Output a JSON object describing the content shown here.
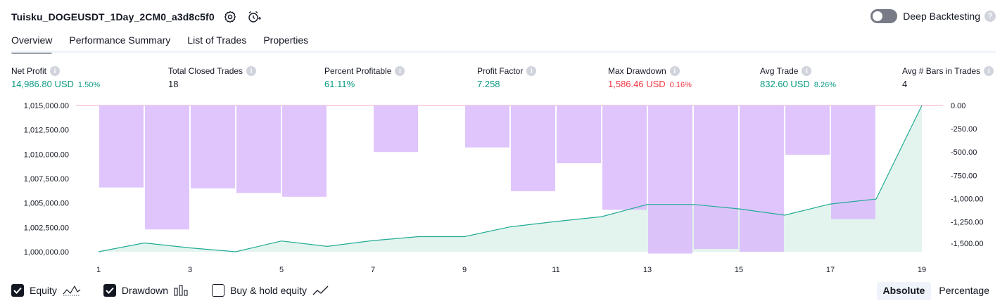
{
  "strategy": {
    "title": "Tuisku_DOGEUSDT_1Day_2CM0_a3d8c5f0",
    "settings_icon": "gear-icon",
    "alert_icon": "alarm-clock-plus-icon"
  },
  "deep_backtesting": {
    "label": "Deep Backtesting",
    "enabled": false,
    "help": "?"
  },
  "tabs": [
    {
      "label": "Overview",
      "active": true
    },
    {
      "label": "Performance Summary",
      "active": false
    },
    {
      "label": "List of Trades",
      "active": false
    },
    {
      "label": "Properties",
      "active": false
    }
  ],
  "metrics": [
    {
      "label": "Net Profit",
      "value": "14,986.80 USD",
      "pct": "1.50%",
      "color": "green"
    },
    {
      "label": "Total Closed Trades",
      "value": "18",
      "pct": "",
      "color": "black"
    },
    {
      "label": "Percent Profitable",
      "value": "61.11%",
      "pct": "",
      "color": "green"
    },
    {
      "label": "Profit Factor",
      "value": "7.258",
      "pct": "",
      "color": "green"
    },
    {
      "label": "Max Drawdown",
      "value": "1,586.46 USD",
      "pct": "0.16%",
      "color": "red"
    },
    {
      "label": "Avg Trade",
      "value": "832.60 USD",
      "pct": "8.26%",
      "color": "green"
    },
    {
      "label": "Avg # Bars in Trades",
      "value": "4",
      "pct": "",
      "color": "black"
    }
  ],
  "chart_data": {
    "type": "line",
    "series": [
      {
        "name": "Equity",
        "axis": "left",
        "chart": "area",
        "x": [
          1,
          2,
          3,
          4,
          5,
          6,
          7,
          8,
          9,
          10,
          11,
          12,
          13,
          14,
          15,
          16,
          17,
          18,
          19
        ],
        "values": [
          1000000,
          1000900,
          1000400,
          1000000,
          1001100,
          1000550,
          1001150,
          1001550,
          1001550,
          1002550,
          1003100,
          1003600,
          1004850,
          1004850,
          1004400,
          1003750,
          1004900,
          1005400,
          1015000
        ]
      },
      {
        "name": "Drawdown",
        "axis": "right",
        "chart": "bar",
        "x": [
          2,
          3,
          4,
          5,
          6,
          7,
          8,
          9,
          10,
          11,
          12,
          13,
          14,
          15,
          16,
          17,
          18,
          19
        ],
        "values": [
          -880,
          -1330,
          -890,
          -940,
          -980,
          0,
          -500,
          0,
          -450,
          -920,
          -620,
          -1120,
          -1590,
          -1540,
          -1570,
          -530,
          -1220,
          0
        ]
      }
    ],
    "left_axis": {
      "ticks": [
        "1,015,000.00",
        "1,012,500.00",
        "1,010,000.00",
        "1,007,500.00",
        "1,005,000.00",
        "1,002,500.00",
        "1,000,000.00"
      ],
      "range": [
        1000000,
        1015000
      ]
    },
    "right_axis": {
      "ticks": [
        "0.00",
        "-250.00",
        "-500.00",
        "-750.00",
        "-1,000.00",
        "-1,250.00",
        "-1,500.00"
      ],
      "range": [
        -1570,
        0
      ]
    },
    "x_ticks": [
      "1",
      "3",
      "5",
      "7",
      "9",
      "11",
      "13",
      "15",
      "17",
      "19"
    ],
    "colors": {
      "equity_line": "#22ab94",
      "equity_fill": "#e3f4ef",
      "drawdown": "#d9b8fd",
      "baseline": "#f7a8c4"
    }
  },
  "legend": [
    {
      "label": "Equity",
      "checked": true,
      "icon": "equity-line-icon"
    },
    {
      "label": "Drawdown",
      "checked": true,
      "icon": "drawdown-bars-icon"
    },
    {
      "label": "Buy & hold equity",
      "checked": false,
      "icon": "buy-hold-line-icon"
    }
  ],
  "scale": {
    "absolute": "Absolute",
    "percentage": "Percentage",
    "selected": "Absolute"
  }
}
